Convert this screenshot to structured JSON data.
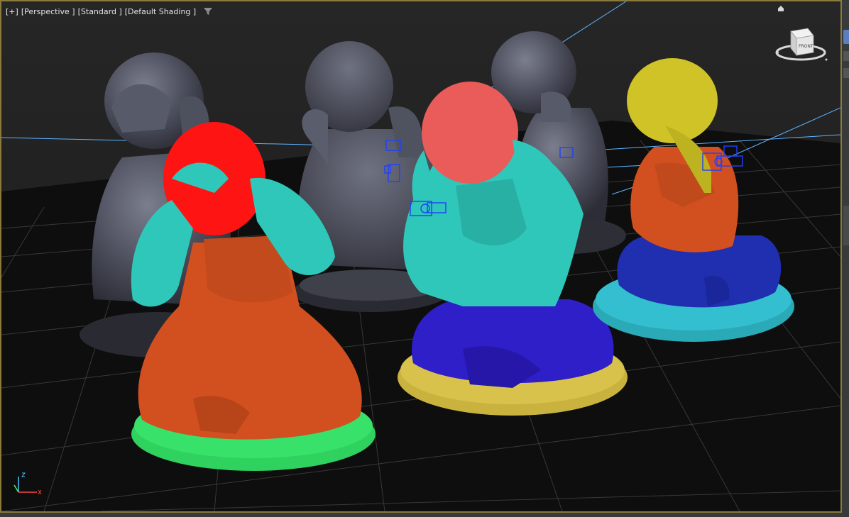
{
  "viewport": {
    "labels": {
      "menu": "[+]",
      "view": "[Perspective ]",
      "mode": "[Standard ]",
      "shading": "[Default Shading ]"
    },
    "icons": {
      "filter": "filter-icon",
      "viewcube": "viewcube-icon",
      "home": "home-icon",
      "axis": "axis-tripod-icon"
    },
    "viewcube_face_label": "FRONT",
    "colors": {
      "frame_border": "#8a7a3c",
      "background": "#202020",
      "grid": "#3c3c3c",
      "light_link": "#5fb3ff",
      "gizmo": "#2040ff"
    }
  },
  "scene": {
    "figures": [
      {
        "name": "see-no-evil",
        "head": "#ff1414",
        "arms": "#2fc7b9",
        "body": "#d2501f",
        "base": "#38e26a"
      },
      {
        "name": "hear-no-evil",
        "head": "#e95c5a",
        "arms": "#2fc7b9",
        "body": "#2e1fc9",
        "base": "#d9c24c"
      },
      {
        "name": "speak-no-evil",
        "head": "#cfc327",
        "arms": "#d2501f",
        "body": "#1f2fb0",
        "base": "#33bfcf"
      }
    ]
  }
}
